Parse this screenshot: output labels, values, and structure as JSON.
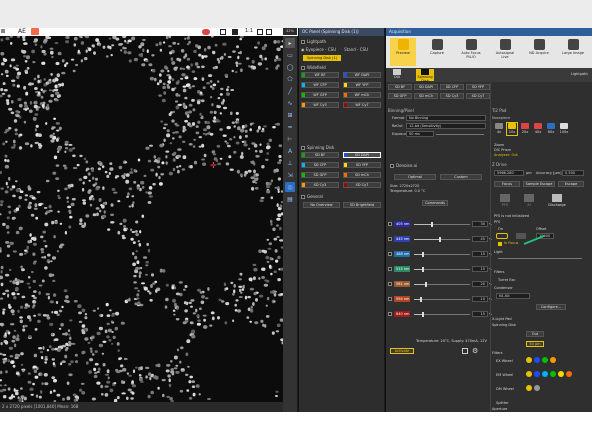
{
  "toolbar": {
    "ae_label": "AE",
    "ratio_label": "1:1",
    "zoom_label": "42%"
  },
  "viewer": {
    "status_text": "2 x 2720 pixels   [1001,840] Mean: 168"
  },
  "oc_panel": {
    "title": "OC Panel (Spinning Disk (1))",
    "lightpath_label": "Lightpath",
    "eyepiece_label": "Eyepiece - CSU",
    "stand_label": "Stand - CSU",
    "spinning_disk_btn": "Spinning Disk (1)",
    "widefield_label": "Widefield",
    "widefield_filters": [
      {
        "label": "WF BF",
        "color": "#00aa00"
      },
      {
        "label": "WF DAPI",
        "color": "#1e4dff"
      },
      {
        "label": "WF CFP",
        "color": "#00b0ff"
      },
      {
        "label": "WF YFP",
        "color": "#ffd800"
      },
      {
        "label": "WF GFP",
        "color": "#00c000"
      },
      {
        "label": "WF mCh",
        "color": "#ff6a00"
      },
      {
        "label": "WF Cy3",
        "color": "#ff9900"
      },
      {
        "label": "WF Cy7",
        "color": "#a00000"
      }
    ],
    "spinning_disk_label": "Spinning Disk",
    "sd_filters": [
      {
        "label": "SD BF",
        "color": "#00aa00"
      },
      {
        "label": "SD DAPI",
        "color": "#1e4dff",
        "selected": true
      },
      {
        "label": "SD CFP",
        "color": "#00b0ff"
      },
      {
        "label": "SD YFP",
        "color": "#ffd800"
      },
      {
        "label": "SD GFP",
        "color": "#00c000"
      },
      {
        "label": "SD mCh",
        "color": "#ff6a00"
      },
      {
        "label": "SD Cy3",
        "color": "#ff9900"
      },
      {
        "label": "SD Cy7",
        "color": "#a00000"
      }
    ],
    "general_label": "General",
    "no_overview_btn": "No Overview",
    "sd_brightfield_btn": "SD Brightfield"
  },
  "acquisition": {
    "title": "Acquisition",
    "lightpath_link": "Lightpath",
    "ribbon": [
      "Preview",
      "Capture",
      "Auto Focus PLUO",
      "Autosignal Live",
      "ND Acquire",
      "Large Image"
    ],
    "tabs": [
      "DIA",
      "Spinning Disk"
    ],
    "filter_btns": [
      "SD BF",
      "SD DAPI",
      "SD CFP",
      "SD YFP",
      "SD GFP",
      "SD mCh",
      "SD Cy3",
      "SD Cy7"
    ],
    "binning_label": "Binning/Pixel",
    "format_label": "Format",
    "format_value": "No Binning",
    "readout_label": "ReOut",
    "readout_value": "12-bit (Sensitivity)",
    "exposure_label": "Exposure",
    "exposure_value": "50 ms",
    "denoise_label": "Denoise.ai",
    "optimal_btn": "Optimal",
    "custom_btn": "Custom",
    "size_text": "Size: 2720x2720",
    "temp_text": "Temperature: 0.0 °C",
    "commands_btn": "Commands",
    "lasers": [
      {
        "name": "405 nm",
        "value": "30",
        "color": "#2a2aa0"
      },
      {
        "name": "445 nm",
        "value": "45",
        "color": "#2f40b0"
      },
      {
        "name": "488 nm",
        "value": "15",
        "color": "#1f6fa8"
      },
      {
        "name": "515 nm",
        "value": "15",
        "color": "#2a8a66"
      },
      {
        "name": "561 nm",
        "value": "20",
        "color": "#9b5a2a"
      },
      {
        "name": "594 nm",
        "value": "10",
        "color": "#b04420"
      },
      {
        "name": "640 nm",
        "value": "15",
        "color": "#a01a1a"
      }
    ],
    "laser_unit": "%",
    "laser_status": "Temperature: 20°C, Supply: 470mA, 12V",
    "activate_btn": "Activate",
    "ti2_label": "Ti2 Pad",
    "nosepiece_label": "Nosepiece",
    "objectives": [
      "4x",
      "10x",
      "20x",
      "40x",
      "60x",
      "100x"
    ],
    "zoom_label": "Zoom",
    "dic_prism_label": "DIC Prism",
    "analyzer_label": "Analyzer: Out",
    "zdrive_label": "Z Drive",
    "z_value": "5966.280",
    "z_unit": "µm",
    "accuracy_label": "Accuracy [µm]",
    "accuracy_value": "0.500",
    "focus_btn": "Focus",
    "sample_escape_btn": "Sample Escape",
    "escape_btn": "Escape",
    "pfs_label": "PFS",
    "ai_label": "AI",
    "discharge_label": "Discharge",
    "pfs_status": "PFS is not initialized",
    "pfs_section": "PFS",
    "pfs_on_label": "On",
    "pfs_offset_label": "Offset",
    "pfs_offset_value": "10400",
    "in_focus_label": "In Focus",
    "light_label": "Light",
    "filters_label": "Filters",
    "turret_label": "Turret Exc",
    "condenser_label": "Condenser",
    "condenser_value": "N1-Kit",
    "configure_btn": "Configure...",
    "xlight_label": "X-Light Pad",
    "sd_label": "Spinning Disk",
    "sd_btn": "Out",
    "sd_pinhole_btn": "50 µm",
    "filters2_label": "Filters",
    "ex_wheel_label": "EX Wheel",
    "em_wheel_label": "EM Wheel",
    "dm_wheel_label": "DM Wheel",
    "splitter_label": "Splitter",
    "aperture_label": "Aperture"
  }
}
